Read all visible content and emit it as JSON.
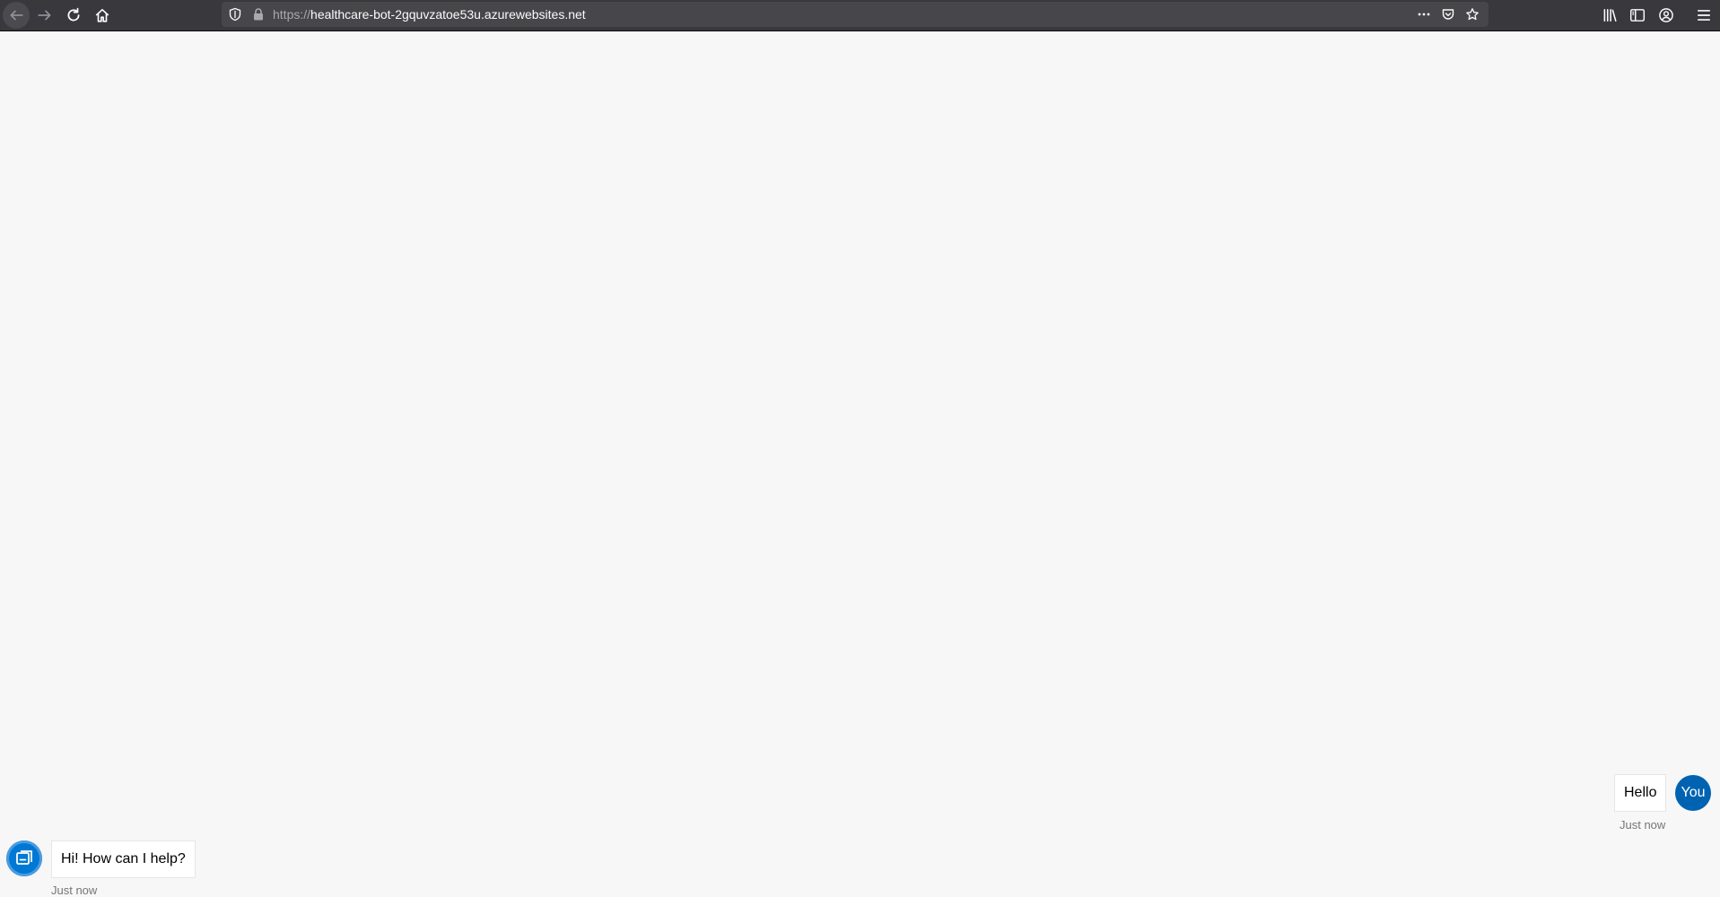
{
  "browser": {
    "url_protocol": "https://",
    "url_host": "healthcare-bot-2gquvzatoe53u.azurewebsites.net",
    "icons": [
      "back-icon",
      "forward-icon",
      "reload-icon",
      "home-icon",
      "tracking-protection-icon",
      "lock-icon",
      "page-actions-icon",
      "pocket-icon",
      "bookmark-star-icon",
      "library-icon",
      "sidebar-icon",
      "account-icon",
      "menu-icon"
    ]
  },
  "chat": {
    "messages": [
      {
        "sender": "user",
        "text": "Hello",
        "timestamp": "Just now",
        "avatar_label": "You"
      },
      {
        "sender": "bot",
        "text": "Hi! How can I help?",
        "timestamp": "Just now"
      }
    ],
    "colors": {
      "user_avatar": "#0063b1",
      "bot_avatar": "#0078d4",
      "background": "#f7f7f7"
    }
  }
}
